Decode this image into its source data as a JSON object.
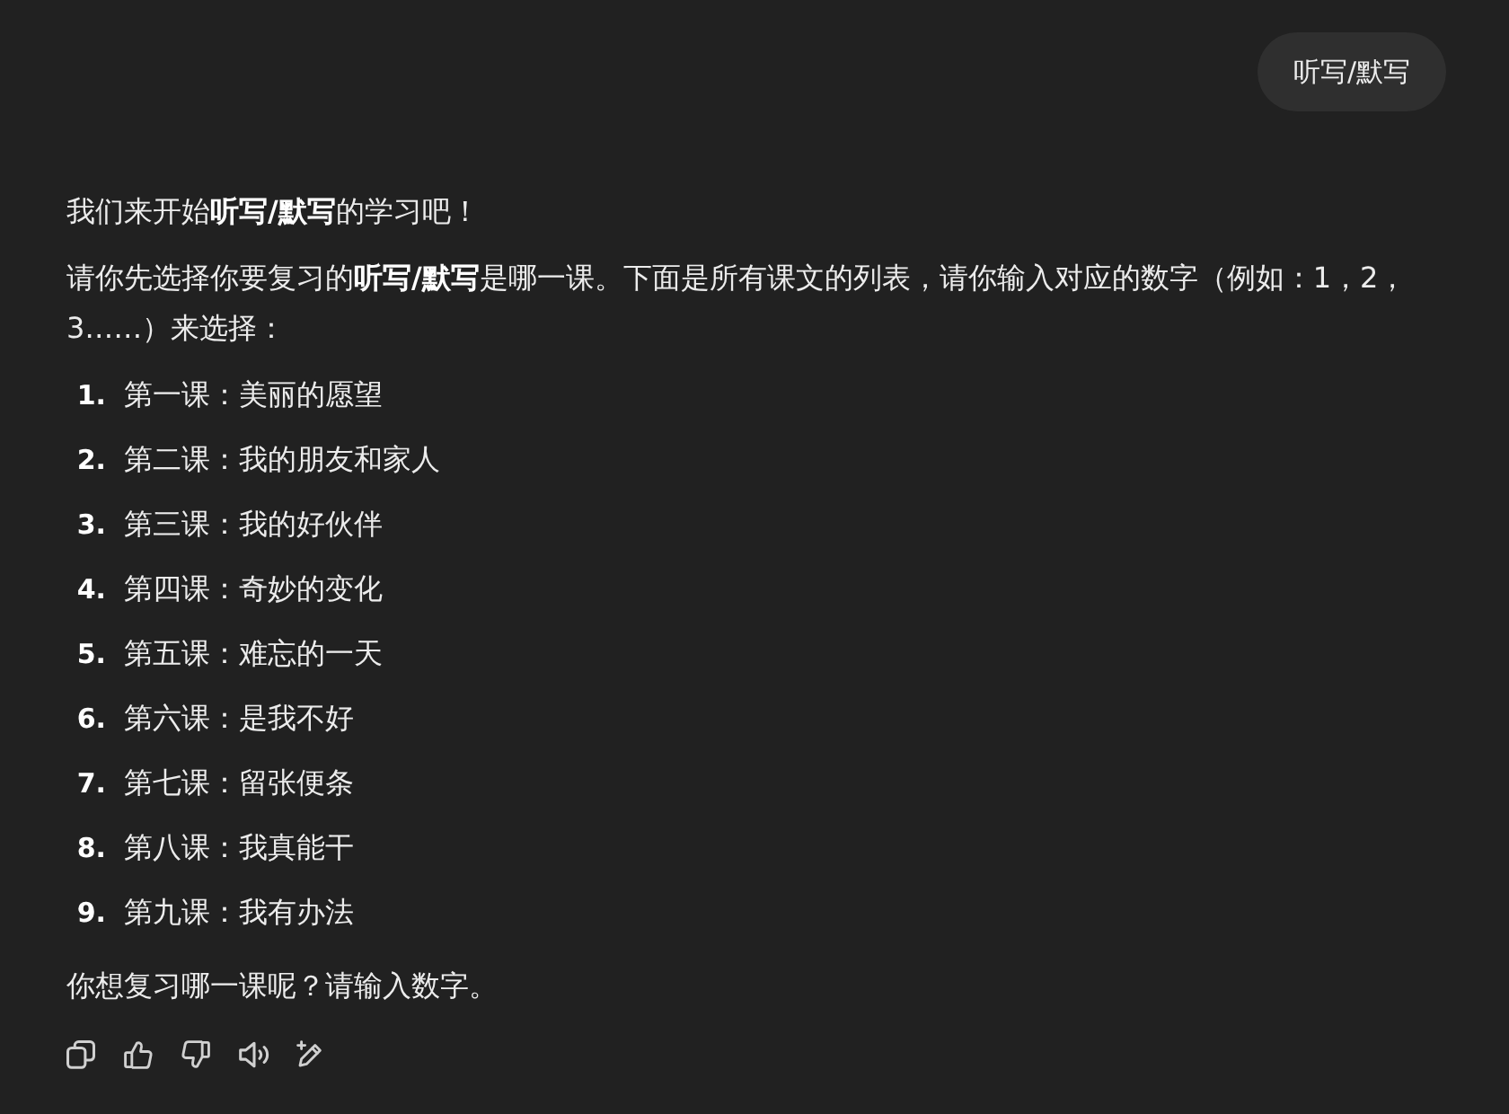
{
  "user_message": {
    "text": "听写/默写"
  },
  "assistant_message": {
    "intro": [
      "我们来开始**听写/默写**的学习吧！",
      "请你先选择你要复习的**听写/默写**是哪一课。下面是所有课文的列表，请你输入对应的数字（例如：1，2，3……）来选择："
    ],
    "lessons": [
      {
        "number": "1.",
        "title": "第一课：美丽的愿望"
      },
      {
        "number": "2.",
        "title": "第二课：我的朋友和家人"
      },
      {
        "number": "3.",
        "title": "第三课：我的好伙伴"
      },
      {
        "number": "4.",
        "title": "第四课：奇妙的变化"
      },
      {
        "number": "5.",
        "title": "第五课：难忘的一天"
      },
      {
        "number": "6.",
        "title": "第六课：是我不好"
      },
      {
        "number": "7.",
        "title": "第七课：留张便条"
      },
      {
        "number": "8.",
        "title": "第八课：我真能干"
      },
      {
        "number": "9.",
        "title": "第九课：我有办法"
      }
    ],
    "closing": "你想复习哪一课呢？请输入数字。"
  }
}
